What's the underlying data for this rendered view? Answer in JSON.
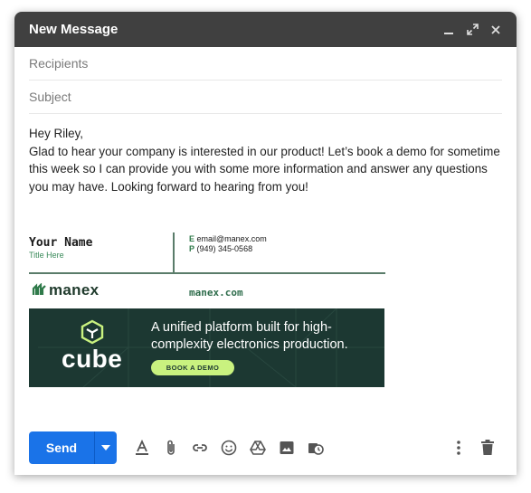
{
  "window": {
    "title": "New Message"
  },
  "compose": {
    "recipients_placeholder": "Recipients",
    "subject_placeholder": "Subject",
    "greeting": "Hey Riley,",
    "message": "Glad to hear your company is interested in our product! Let’s book a demo for sometime this week so I can provide you with some more information and answer any questions you may have. Looking forward to hearing from you!"
  },
  "signature": {
    "name": "Your Name",
    "title": "Title Here",
    "email_label": "E",
    "email": "email@manex.com",
    "phone_label": "P",
    "phone": "(949) 345-0568",
    "company": "manex",
    "website": "manex.com"
  },
  "banner": {
    "logo_text": "cube",
    "headline": "A unified platform built for high-complexity electronics production.",
    "cta": "BOOK A DEMO"
  },
  "toolbar": {
    "send_label": "Send",
    "tools": [
      "text-format-icon",
      "attach-icon",
      "link-icon",
      "emoji-icon",
      "drive-icon",
      "photo-icon",
      "schedule-icon"
    ]
  },
  "colors": {
    "send": "#1a73e8",
    "titlebar": "#404040",
    "banner": "#1c3832",
    "cta": "#c9f27f"
  }
}
